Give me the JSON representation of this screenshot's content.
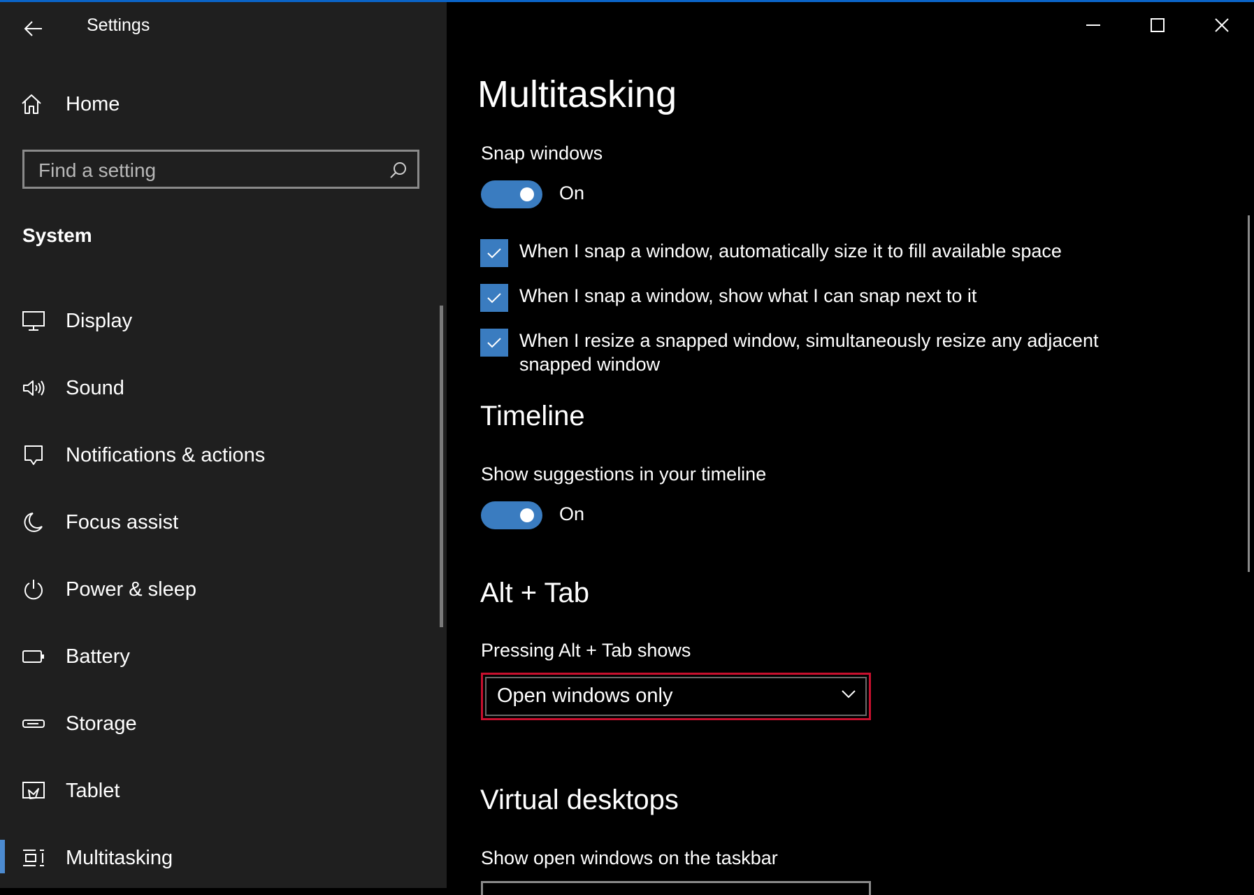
{
  "window": {
    "title": "Settings",
    "accent_color": "#0a64c8",
    "controls": [
      "minimize-icon",
      "maximize-icon",
      "close-icon"
    ]
  },
  "sidebar": {
    "home_label": "Home",
    "search_placeholder": "Find a setting",
    "section": "System",
    "items": [
      {
        "label": "Display",
        "icon": "display-icon"
      },
      {
        "label": "Sound",
        "icon": "speaker-icon"
      },
      {
        "label": "Notifications & actions",
        "icon": "notification-icon"
      },
      {
        "label": "Focus assist",
        "icon": "moon-icon"
      },
      {
        "label": "Power & sleep",
        "icon": "power-icon"
      },
      {
        "label": "Battery",
        "icon": "battery-icon"
      },
      {
        "label": "Storage",
        "icon": "storage-icon"
      },
      {
        "label": "Tablet",
        "icon": "tablet-icon"
      },
      {
        "label": "Multitasking",
        "icon": "multitasking-icon",
        "selected": true
      }
    ]
  },
  "main": {
    "title": "Multitasking",
    "snap": {
      "label": "Snap windows",
      "toggle_state": "On",
      "options": [
        {
          "text": "When I snap a window, automatically size it to fill available space",
          "checked": true
        },
        {
          "text": "When I snap a window, show what I can snap next to it",
          "checked": true
        },
        {
          "text": "When I resize a snapped window, simultaneously resize any adjacent snapped window",
          "checked": true
        }
      ]
    },
    "timeline": {
      "heading": "Timeline",
      "label": "Show suggestions in your timeline",
      "toggle_state": "On"
    },
    "alt_tab": {
      "heading": "Alt + Tab",
      "label": "Pressing Alt + Tab shows",
      "selected": "Open windows only"
    },
    "virtual_desktops": {
      "heading": "Virtual desktops",
      "label": "Show open windows on the taskbar"
    }
  }
}
